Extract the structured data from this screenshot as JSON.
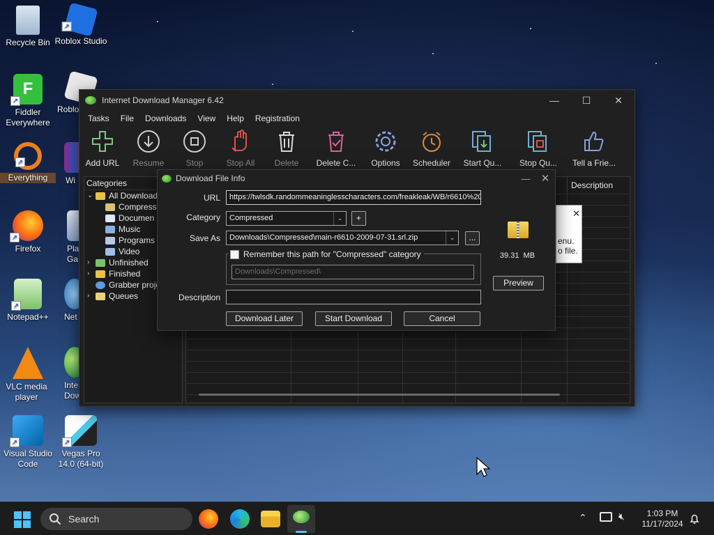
{
  "desktop": {
    "icons": [
      {
        "label": "Recycle Bin",
        "icon": "recycle-bin-icon"
      },
      {
        "label": "Roblox Studio",
        "icon": "roblox-studio-icon"
      },
      {
        "label": "Fiddler Everywhere",
        "icon": "fiddler-icon"
      },
      {
        "label": "Roblox",
        "icon": "roblox-icon"
      },
      {
        "label": "Everything",
        "icon": "everything-search-icon"
      },
      {
        "label": "Wi",
        "icon": "winrar-icon"
      },
      {
        "label": "Firefox",
        "icon": "firefox-icon"
      },
      {
        "label": "Pla Ga",
        "icon": "play-games-icon"
      },
      {
        "label": "Notepad++",
        "icon": "notepadpp-icon"
      },
      {
        "label": "Net",
        "icon": "net-icon"
      },
      {
        "label": "VLC media player",
        "icon": "vlc-icon"
      },
      {
        "label": "Inte Dow",
        "icon": "idm-icon"
      },
      {
        "label": "Visual Studio Code",
        "icon": "vscode-icon"
      },
      {
        "label": "Vegas Pro 14.0 (64-bit)",
        "icon": "vegas-pro-icon"
      }
    ]
  },
  "idm": {
    "title": "Internet Download Manager 6.42",
    "menu": [
      "Tasks",
      "File",
      "Downloads",
      "View",
      "Help",
      "Registration"
    ],
    "toolbar": [
      {
        "label": "Add URL",
        "icon": "add-url-icon",
        "enabled": true
      },
      {
        "label": "Resume",
        "icon": "resume-icon",
        "enabled": false
      },
      {
        "label": "Stop",
        "icon": "stop-icon",
        "enabled": false
      },
      {
        "label": "Stop All",
        "icon": "stop-all-icon",
        "enabled": false
      },
      {
        "label": "Delete",
        "icon": "delete-icon",
        "enabled": false
      },
      {
        "label": "Delete C...",
        "icon": "delete-completed-icon",
        "enabled": true
      },
      {
        "label": "Options",
        "icon": "options-icon",
        "enabled": true
      },
      {
        "label": "Scheduler",
        "icon": "scheduler-icon",
        "enabled": true
      },
      {
        "label": "Start Qu...",
        "icon": "start-queue-icon",
        "enabled": true
      },
      {
        "label": "Stop Qu...",
        "icon": "stop-queue-icon",
        "enabled": true
      },
      {
        "label": "Tell a Frie...",
        "icon": "tell-a-friend-icon",
        "enabled": true
      }
    ],
    "categories_header": "Categories",
    "tree": {
      "all": "All Downloads",
      "children": [
        "Compress",
        "Documen",
        "Music",
        "Programs",
        "Video"
      ],
      "others": [
        "Unfinished",
        "Finished",
        "Grabber proje",
        "Queues"
      ]
    },
    "column_description": "Description",
    "tip_lines": [
      "enu.",
      "o file."
    ]
  },
  "dialog": {
    "title": "Download File Info",
    "url_label": "URL",
    "url_value": "https://twlsdk.randommeaninglesscharacters.com/freakleak/WB/r6610%20",
    "category_label": "Category",
    "category_value": "Compressed",
    "add_category": "+",
    "saveas_label": "Save As",
    "saveas_value": "Downloads\\Compressed\\main-r6610-2009-07-31.srl.zip",
    "browse": "...",
    "remember_label": "Remember this path for \"Compressed\" category",
    "remember_path": "Downloads\\Compressed\\",
    "description_label": "Description",
    "description_value": "",
    "file_size": "39.31  MB",
    "preview": "Preview",
    "download_later": "Download Later",
    "start_download": "Start Download",
    "cancel": "Cancel"
  },
  "taskbar": {
    "search_placeholder": "Search",
    "time": "1:03 PM",
    "date": "11/17/2024"
  }
}
